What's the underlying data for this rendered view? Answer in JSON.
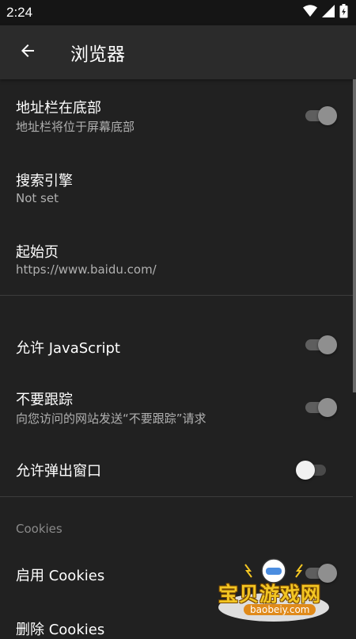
{
  "status_bar": {
    "time": "2:24",
    "icons": [
      "wifi-icon",
      "signal-icon",
      "battery-icon"
    ]
  },
  "app_bar": {
    "back_icon": "arrow-back-icon",
    "title": "浏览器"
  },
  "settings": {
    "address_bar_bottom": {
      "title": "地址栏在底部",
      "subtitle": "地址栏将位于屏幕底部",
      "enabled": true
    },
    "search_engine": {
      "title": "搜索引擎",
      "subtitle": "Not set"
    },
    "start_page": {
      "title": "起始页",
      "subtitle": "https://www.baidu.com/"
    },
    "allow_javascript": {
      "title": "允许 JavaScript",
      "enabled": true
    },
    "do_not_track": {
      "title": "不要跟踪",
      "subtitle": "向您访问的网站发送“不要跟踪”请求",
      "enabled": true
    },
    "allow_popups": {
      "title": "允许弹出窗口",
      "enabled": false
    },
    "cookies_section": {
      "header": "Cookies"
    },
    "enable_cookies": {
      "title": "启用 Cookies",
      "enabled": true
    },
    "delete_cookies": {
      "title": "删除 Cookies"
    }
  },
  "watermark": {
    "text": "宝贝游戏网",
    "url": "baobeiy.com"
  },
  "colors": {
    "background": "#212121",
    "app_bar": "#2b2b2b",
    "status_bar": "#151515",
    "secondary_text": "#b0b0b0",
    "section_header": "#8a8a8a"
  }
}
